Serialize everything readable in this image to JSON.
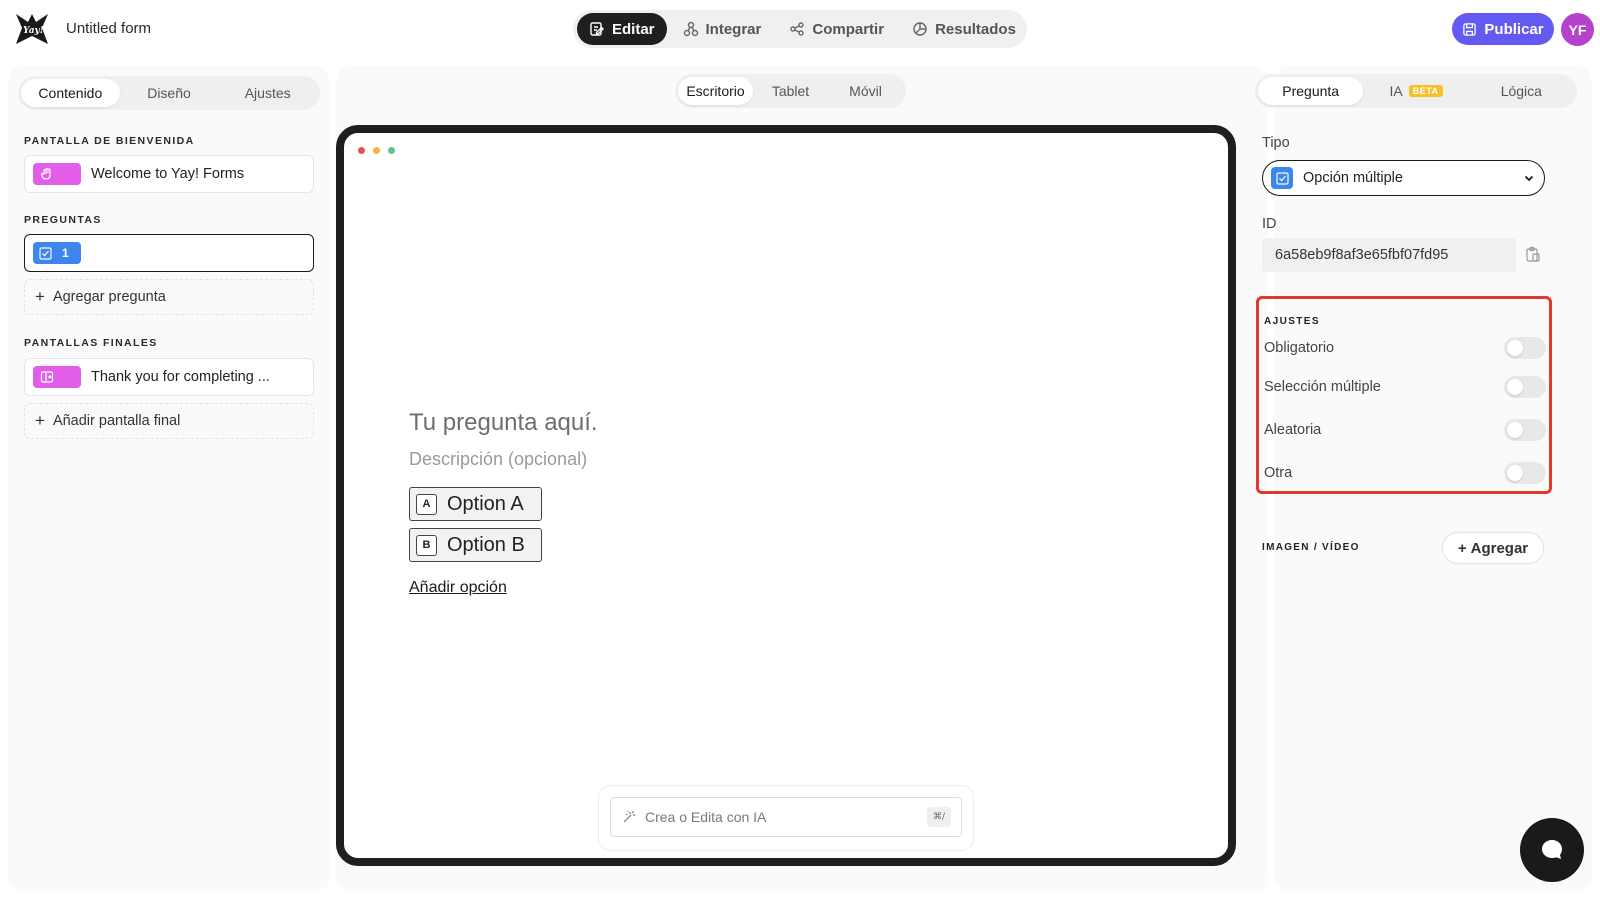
{
  "header": {
    "form_title": "Untitled form",
    "nav": [
      {
        "label": "Editar",
        "icon": "edit-icon",
        "active": true
      },
      {
        "label": "Integrar",
        "icon": "integrate-icon",
        "active": false
      },
      {
        "label": "Compartir",
        "icon": "share-icon",
        "active": false
      },
      {
        "label": "Resultados",
        "icon": "results-icon",
        "active": false
      }
    ],
    "publish_label": "Publicar",
    "avatar_initials": "YF",
    "avatar_color": "#b443c9",
    "accent_color": "#6459f0"
  },
  "left": {
    "tabs": [
      "Contenido",
      "Diseño",
      "Ajustes"
    ],
    "welcome_section": "PANTALLA DE BIENVENIDA",
    "welcome_item": "Welcome to Yay! Forms",
    "questions_section": "PREGUNTAS",
    "question_number": "1",
    "add_question": "Agregar pregunta",
    "final_section": "PANTALLAS FINALES",
    "final_item": "Thank you for completing ...",
    "add_final": "Añadir pantalla final"
  },
  "center": {
    "device_tabs": [
      "Escritorio",
      "Tablet",
      "Móvil"
    ],
    "question_title": "Tu pregunta aquí.",
    "question_desc": "Descripción (opcional)",
    "options": [
      {
        "key": "A",
        "label": "Option A"
      },
      {
        "key": "B",
        "label": "Option B"
      }
    ],
    "add_option": "Añadir opción",
    "ai_placeholder": "Crea o Edita con IA",
    "ai_shortcut": "⌘/"
  },
  "right": {
    "tabs": [
      "Pregunta",
      "IA",
      "Lógica"
    ],
    "beta_badge": "BETA",
    "type_label": "Tipo",
    "type_value": "Opción múltiple",
    "id_label": "ID",
    "id_value": "6a58eb9f8af3e65fbf07fd95",
    "settings_title": "AJUSTES",
    "settings": [
      {
        "label": "Obligatorio",
        "on": false
      },
      {
        "label": "Selección múltiple",
        "on": false
      },
      {
        "label": "Aleatoria",
        "on": false
      },
      {
        "label": "Otra",
        "on": false
      }
    ],
    "media_label": "IMAGEN / VÍDEO",
    "add_media": "Agregar"
  }
}
